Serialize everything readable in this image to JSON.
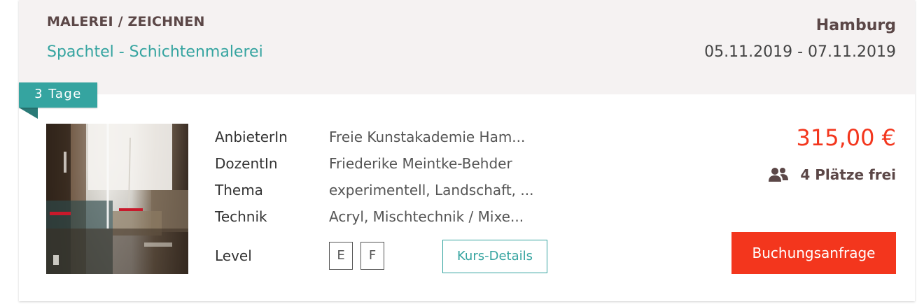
{
  "header": {
    "category": "MALEREI / ZEICHNEN",
    "title": "Spachtel - Schichtenmalerei",
    "city": "Hamburg",
    "dates": "05.11.2019 - 07.11.2019"
  },
  "duration": "3 Tage",
  "details": {
    "provider_label": "AnbieterIn",
    "provider_value": "Freie Kunstakademie Ham...",
    "instructor_label": "DozentIn",
    "instructor_value": "Friederike Meintke-Behder",
    "topic_label": "Thema",
    "topic_value": "experimentell, Landschaft, ...",
    "technique_label": "Technik",
    "technique_value": "Acryl, Mischtechnik / Mixe...",
    "level_label": "Level",
    "levels": [
      "E",
      "F"
    ],
    "details_button": "Kurs-Details"
  },
  "pricing": {
    "price": "315,00 €",
    "seats": "4 Plätze frei",
    "seats_icon": "people-icon",
    "book_button": "Buchungsanfrage"
  },
  "colors": {
    "accent_teal": "#35a4a0",
    "accent_red": "#f3361d",
    "header_bg": "#f5f2f2",
    "heading_brown": "#5b4747"
  }
}
